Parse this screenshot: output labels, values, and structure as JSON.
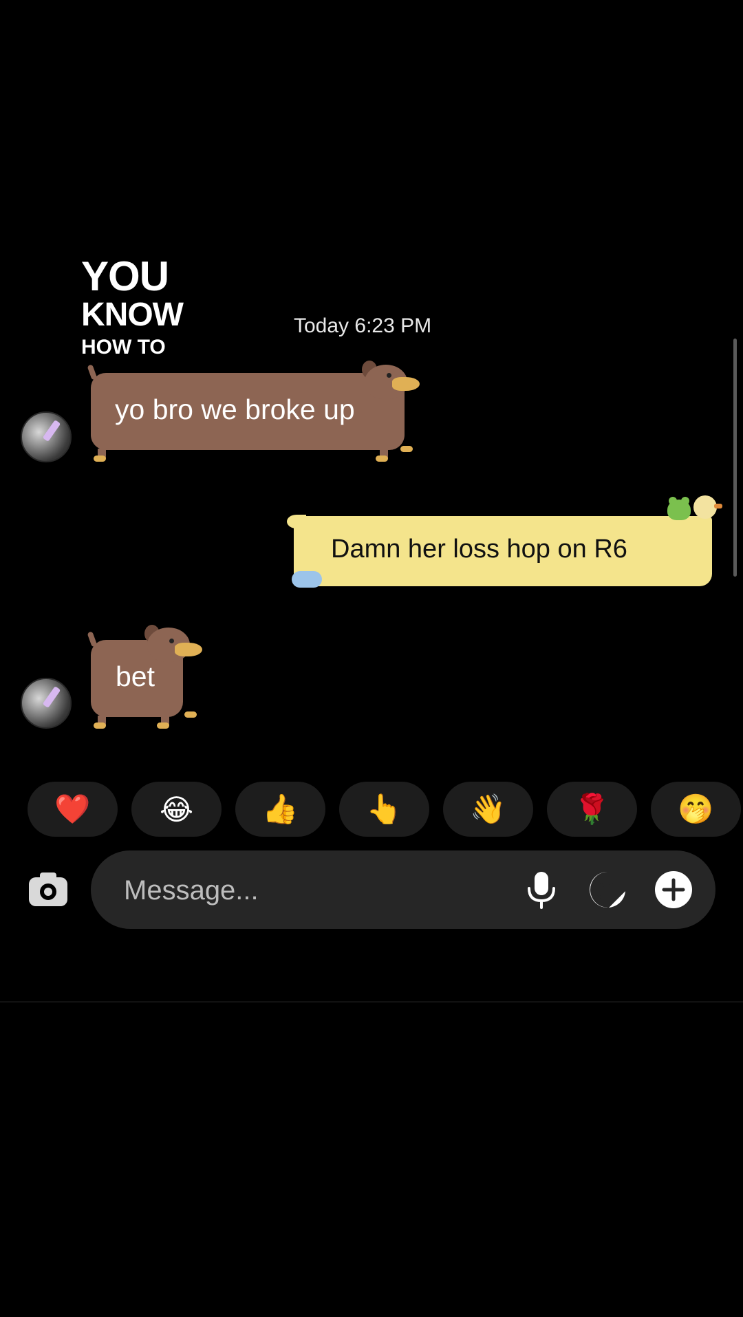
{
  "watermark": {
    "line1": "YOU",
    "line2": "KNOW",
    "line3": "HOW TO"
  },
  "conversation": {
    "timestamp": "Today 6:23 PM",
    "messages": [
      {
        "sender": "other",
        "text": "yo bro we broke up"
      },
      {
        "sender": "self",
        "text": "Damn her loss hop on R6"
      },
      {
        "sender": "other",
        "text": "bet"
      }
    ]
  },
  "reactions": [
    {
      "emoji": "❤️",
      "icon": "heart-icon"
    },
    {
      "emoji": "😂",
      "icon": "laughing-tears-icon"
    },
    {
      "emoji": "👍",
      "icon": "thumbs-up-icon"
    },
    {
      "emoji": "👆",
      "icon": "pointing-up-icon"
    },
    {
      "emoji": "👋",
      "icon": "waving-hand-icon"
    },
    {
      "emoji": "🌹",
      "icon": "rose-icon"
    },
    {
      "emoji": "🤭",
      "icon": "hand-over-mouth-icon"
    }
  ],
  "composer": {
    "placeholder": "Message...",
    "icons": [
      "camera-icon",
      "microphone-icon",
      "sticker-icon",
      "plus-icon"
    ]
  },
  "colors": {
    "background": "#000000",
    "received_bubble": "#8d6553",
    "sent_bubble": "#f4e48c",
    "composer": "#262626",
    "reaction_pill": "#1d1d1d"
  }
}
